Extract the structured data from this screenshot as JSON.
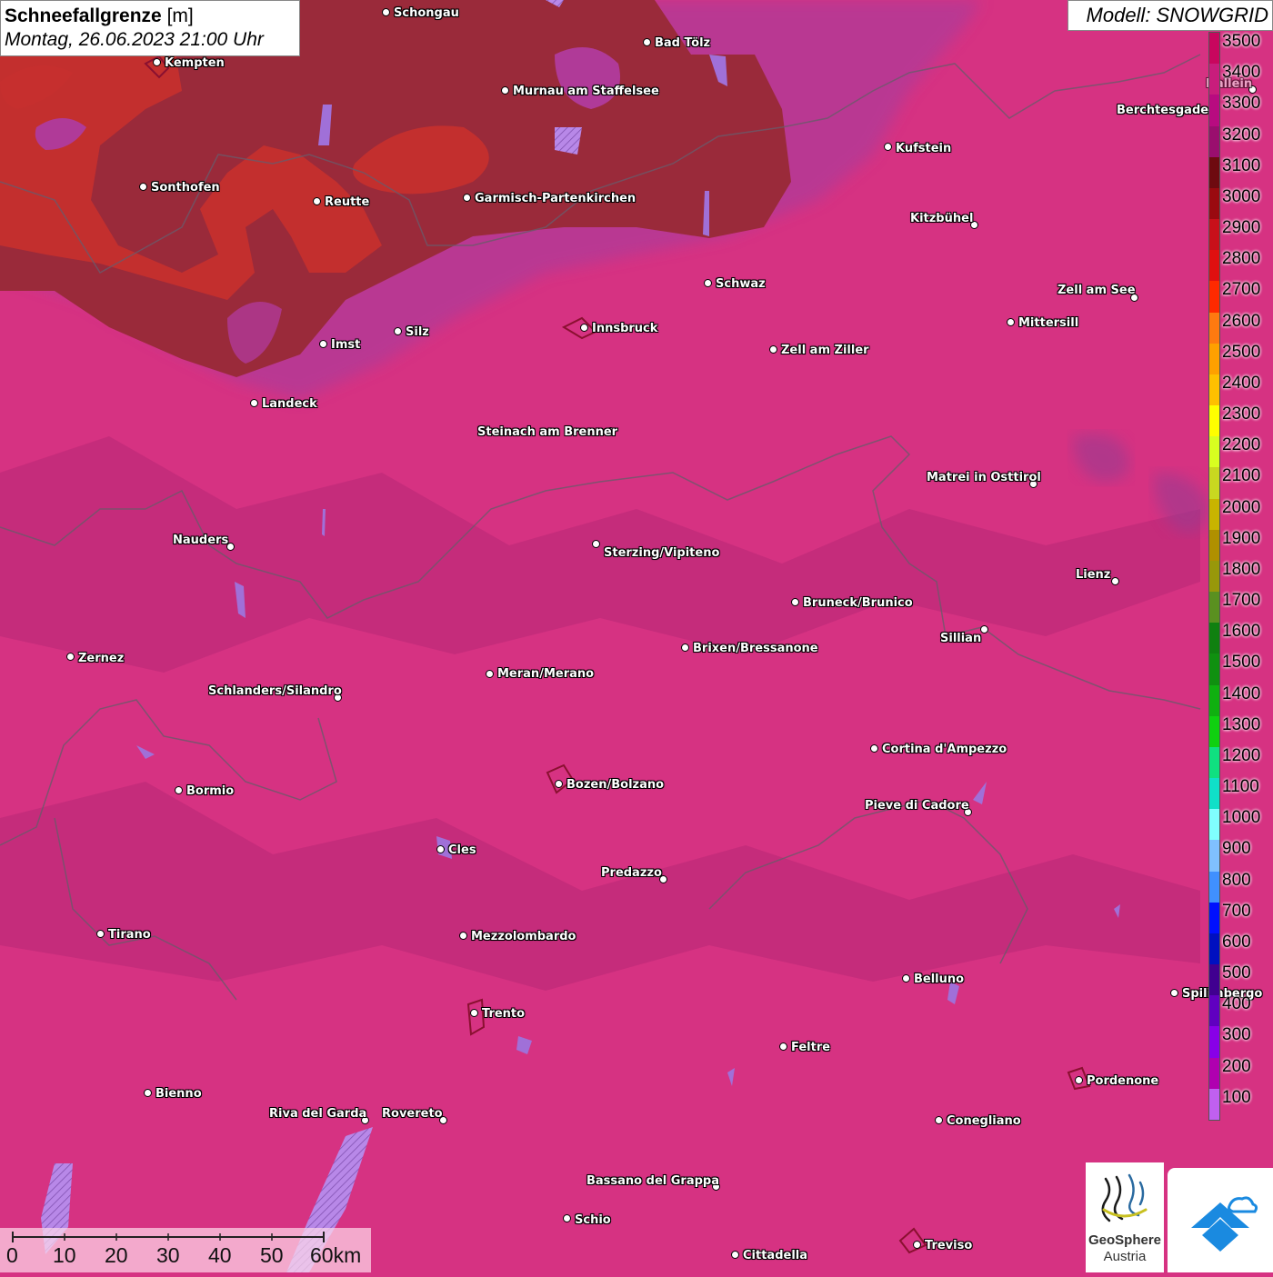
{
  "header": {
    "title": "Schneefallgrenze",
    "unit": "[m]",
    "datetime": "Montag, 26.06.2023 21:00 Uhr",
    "model": "Modell: SNOWGRID"
  },
  "legend": {
    "ticks": [
      "3500",
      "3400",
      "3300",
      "3200",
      "3100",
      "3000",
      "2900",
      "2800",
      "2700",
      "2600",
      "2500",
      "2400",
      "2300",
      "2200",
      "2100",
      "2000",
      "1900",
      "1800",
      "1700",
      "1600",
      "1500",
      "1400",
      "1300",
      "1200",
      "1100",
      "1000",
      "900",
      "800",
      "700",
      "600",
      "500",
      "400",
      "300",
      "200",
      "100"
    ],
    "colors": [
      "#c8065e",
      "#c81d7c",
      "#b80b80",
      "#9a0e6e",
      "#6e0a10",
      "#9a0a10",
      "#c8101a",
      "#e01010",
      "#ff2a00",
      "#ff7a10",
      "#ffa000",
      "#ffc000",
      "#ffff00",
      "#d8ff20",
      "#c8d820",
      "#c8b400",
      "#b09000",
      "#98980a",
      "#5a9020",
      "#108010",
      "#109010",
      "#10b010",
      "#10d010",
      "#10e080",
      "#10e0c8",
      "#80ffff",
      "#80c0ff",
      "#4090ff",
      "#0010ff",
      "#0010c0",
      "#400090",
      "#6000c0",
      "#8800e8",
      "#b000b0",
      "#c060f0"
    ]
  },
  "cities": [
    {
      "name": "Schongau"
    },
    {
      "name": "Bad Tölz"
    },
    {
      "name": "Kempten"
    },
    {
      "name": "Murnau am Staffelsee"
    },
    {
      "name": "Berchtesgaden"
    },
    {
      "name": "Kufstein"
    },
    {
      "name": "Sonthofen"
    },
    {
      "name": "Reutte"
    },
    {
      "name": "Garmisch-Partenkirchen"
    },
    {
      "name": "Kitzbühel"
    },
    {
      "name": "Schwaz"
    },
    {
      "name": "Zell am See"
    },
    {
      "name": "Mittersill"
    },
    {
      "name": "Innsbruck"
    },
    {
      "name": "Silz"
    },
    {
      "name": "Imst"
    },
    {
      "name": "Zell am Ziller"
    },
    {
      "name": "Landeck"
    },
    {
      "name": "Steinach am Brenner"
    },
    {
      "name": "Matrei in Osttirol"
    },
    {
      "name": "Nauders"
    },
    {
      "name": "Sterzing/Vipiteno"
    },
    {
      "name": "Lienz"
    },
    {
      "name": "Bruneck/Brunico"
    },
    {
      "name": "Sillian"
    },
    {
      "name": "Brixen/Bressanone"
    },
    {
      "name": "Zernez"
    },
    {
      "name": "Meran/Merano"
    },
    {
      "name": "Schlanders/Silandro"
    },
    {
      "name": "Cortina d'Ampezzo"
    },
    {
      "name": "Bozen/Bolzano"
    },
    {
      "name": "Bormio"
    },
    {
      "name": "Pieve di Cadore"
    },
    {
      "name": "Cles"
    },
    {
      "name": "Predazzo"
    },
    {
      "name": "Tirano"
    },
    {
      "name": "Mezzolombardo"
    },
    {
      "name": "Belluno"
    },
    {
      "name": "Spilimbergo"
    },
    {
      "name": "Trento"
    },
    {
      "name": "Feltre"
    },
    {
      "name": "Pordenone"
    },
    {
      "name": "Bienno"
    },
    {
      "name": "Riva del Garda"
    },
    {
      "name": "Rovereto"
    },
    {
      "name": "Conegliano"
    },
    {
      "name": "Bassano del Grappa"
    },
    {
      "name": "Schio"
    },
    {
      "name": "Treviso"
    },
    {
      "name": "Cittadella"
    },
    {
      "name": "Hallein"
    }
  ],
  "scale_bar": {
    "ticks": [
      "0",
      "10",
      "20",
      "30",
      "40",
      "50",
      "60km"
    ]
  },
  "logos": {
    "geosphere_name": "GeoSphere",
    "geosphere_sub": "Austria"
  },
  "colors": {
    "background_snowline": "#d63282",
    "high_zone": "#9a2a3a",
    "higher_zone": "#c8302e",
    "lake": "#a070d8"
  }
}
